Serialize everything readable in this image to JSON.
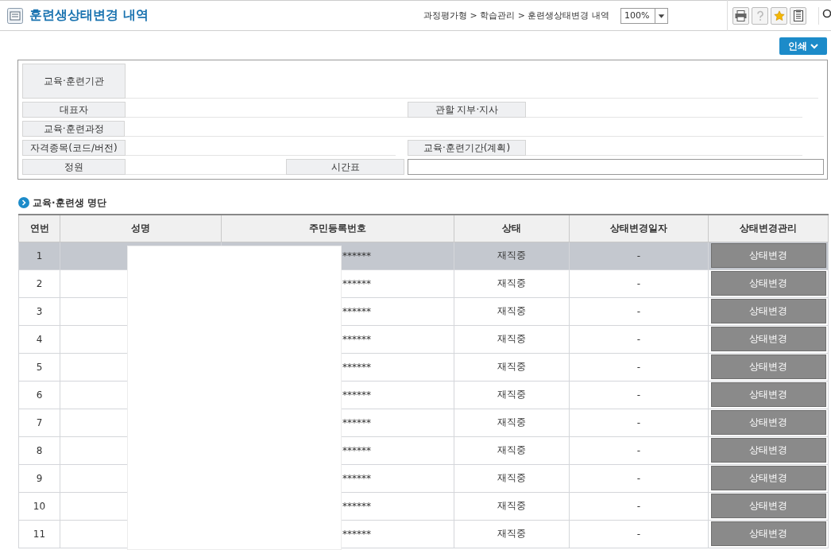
{
  "header": {
    "title": "훈련생상태변경 내역",
    "breadcrumb": "과정평가형 > 학습관리 > 훈련생상태변경 내역",
    "zoom": "100%"
  },
  "print_button": "인쇄",
  "info": {
    "institution": "교육·훈련기관",
    "representative": "대표자",
    "branch": "관할 지부·지사",
    "course": "교육·훈련과정",
    "qualification": "자격종목(코드/버전)",
    "period": "교육·훈련기간(계획)",
    "capacity": "정원",
    "timetable": "시간표"
  },
  "section_title": "교육·훈련생 명단",
  "table": {
    "columns": [
      "연번",
      "성명",
      "주민등록번호",
      "상태",
      "상태변경일자",
      "상태변경관리"
    ],
    "rows": [
      {
        "number": "1",
        "id_number": "******",
        "status": "재직중",
        "changed_date": "-",
        "action": "상태변경",
        "selected": true
      },
      {
        "number": "2",
        "id_number": "******",
        "status": "재직중",
        "changed_date": "-",
        "action": "상태변경",
        "selected": false
      },
      {
        "number": "3",
        "id_number": "******",
        "status": "재직중",
        "changed_date": "-",
        "action": "상태변경",
        "selected": false
      },
      {
        "number": "4",
        "id_number": "******",
        "status": "재직중",
        "changed_date": "-",
        "action": "상태변경",
        "selected": false
      },
      {
        "number": "5",
        "id_number": "******",
        "status": "재직중",
        "changed_date": "-",
        "action": "상태변경",
        "selected": false
      },
      {
        "number": "6",
        "id_number": "******",
        "status": "재직중",
        "changed_date": "-",
        "action": "상태변경",
        "selected": false
      },
      {
        "number": "7",
        "id_number": "******",
        "status": "재직중",
        "changed_date": "-",
        "action": "상태변경",
        "selected": false
      },
      {
        "number": "8",
        "id_number": "******",
        "status": "재직중",
        "changed_date": "-",
        "action": "상태변경",
        "selected": false
      },
      {
        "number": "9",
        "id_number": "******",
        "status": "재직중",
        "changed_date": "-",
        "action": "상태변경",
        "selected": false
      },
      {
        "number": "10",
        "id_number": "******",
        "status": "재직중",
        "changed_date": "-",
        "action": "상태변경",
        "selected": false
      },
      {
        "number": "11",
        "id_number": "******",
        "status": "재직중",
        "changed_date": "-",
        "action": "상태변경",
        "selected": false
      }
    ]
  }
}
